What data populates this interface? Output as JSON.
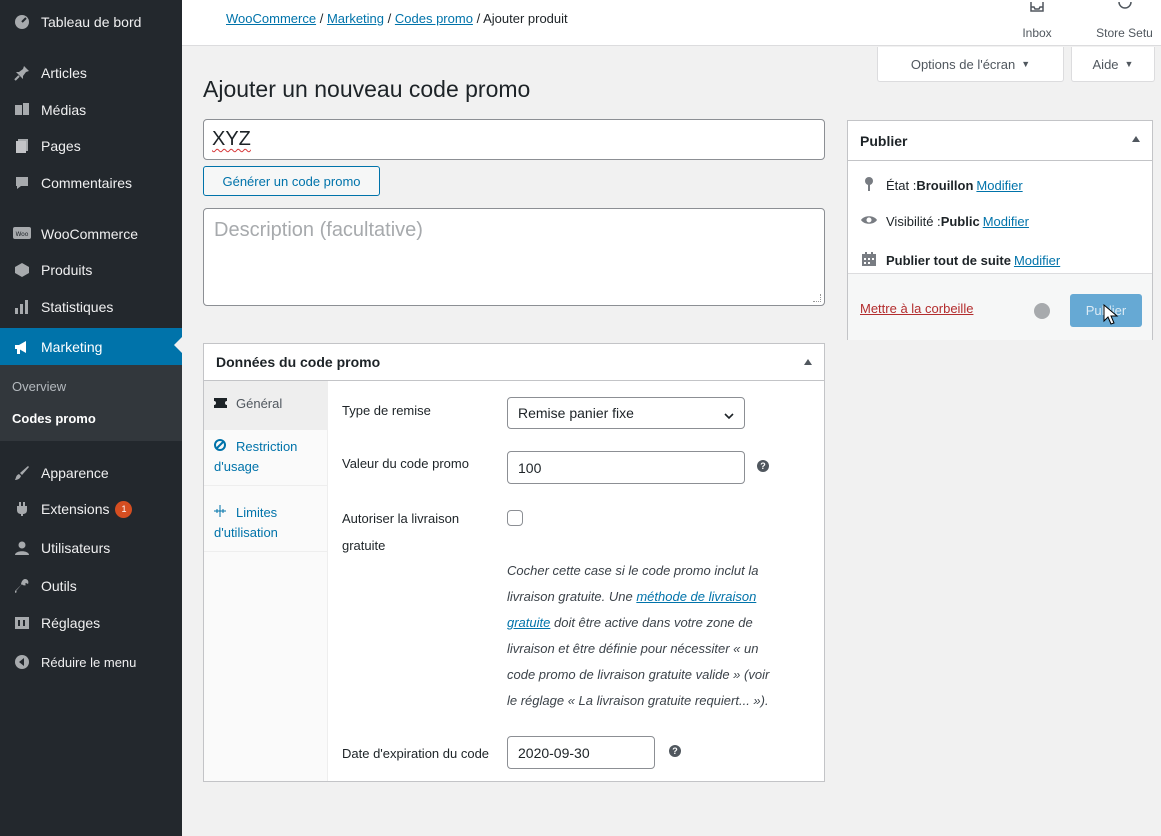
{
  "sidebar": {
    "items": [
      {
        "label": "Tableau de bord",
        "icon": "dashboard-icon"
      },
      {
        "label": "Articles",
        "icon": "pin-icon"
      },
      {
        "label": "Médias",
        "icon": "media-icon"
      },
      {
        "label": "Pages",
        "icon": "pages-icon"
      },
      {
        "label": "Commentaires",
        "icon": "comments-icon"
      },
      {
        "label": "WooCommerce",
        "icon": "woocommerce-icon"
      },
      {
        "label": "Produits",
        "icon": "products-icon"
      },
      {
        "label": "Statistiques",
        "icon": "stats-icon"
      },
      {
        "label": "Marketing",
        "icon": "megaphone-icon"
      },
      {
        "label": "Apparence",
        "icon": "brush-icon"
      },
      {
        "label": "Extensions",
        "icon": "plugin-icon",
        "badge": "1"
      },
      {
        "label": "Utilisateurs",
        "icon": "users-icon"
      },
      {
        "label": "Outils",
        "icon": "wrench-icon"
      },
      {
        "label": "Réglages",
        "icon": "settings-icon"
      },
      {
        "label": "Réduire le menu",
        "icon": "collapse-icon"
      }
    ],
    "submenu": [
      {
        "label": "Overview"
      },
      {
        "label": "Codes promo"
      }
    ]
  },
  "breadcrumb": {
    "links": [
      "WooCommerce",
      "Marketing",
      "Codes promo"
    ],
    "current": "Ajouter produit",
    "separator": "/"
  },
  "top_actions": {
    "inbox": "Inbox",
    "store_setup": "Store Setu"
  },
  "screen_options": {
    "options": "Options de l'écran",
    "help": "Aide"
  },
  "page": {
    "title": "Ajouter un nouveau code promo",
    "coupon_code": "XYZ",
    "generate_button": "Générer un code promo",
    "description_placeholder": "Description (facultative)"
  },
  "coupon_data": {
    "title": "Données du code promo",
    "tabs": [
      {
        "label": "Général",
        "icon": "ticket-icon"
      },
      {
        "label": "Restriction d'usage",
        "icon": "block-icon"
      },
      {
        "label": "Limites d'utilisation",
        "icon": "limits-icon"
      }
    ],
    "fields": {
      "discount_type_label": "Type de remise",
      "discount_type_value": "Remise panier fixe",
      "amount_label": "Valeur du code promo",
      "amount_value": "100",
      "free_shipping_label_1": "Autoriser la livraison",
      "free_shipping_label_2": "gratuite",
      "free_shipping_checked": false,
      "help_line_1": "Cocher cette case si le code promo inclut la",
      "help_line_2_prefix": "livraison gratuite. Une ",
      "help_link_1": "méthode de livraison",
      "help_link_2": "gratuite",
      "help_line_3_suffix": " doit être active dans votre zone de",
      "help_line_4": "livraison et être définie pour nécessiter « un",
      "help_line_5": "code promo de livraison gratuite valide » (voir",
      "help_line_6": "le réglage « La livraison gratuite requiert... »).",
      "expiry_label": "Date d'expiration du code",
      "expiry_value": "2020-09-30"
    }
  },
  "publish": {
    "title": "Publier",
    "status_label": "État : ",
    "status_value": "Brouillon",
    "visibility_label": "Visibilité : ",
    "visibility_value": "Public",
    "schedule_label": "Publier tout de suite",
    "edit_link": "Modifier",
    "trash": "Mettre à la corbeille",
    "publish_button": "Publier"
  },
  "colors": {
    "sidebar_bg": "#23282d",
    "accent": "#0073aa",
    "publish_button": "#66a9d4",
    "trash": "#b32d2e"
  }
}
